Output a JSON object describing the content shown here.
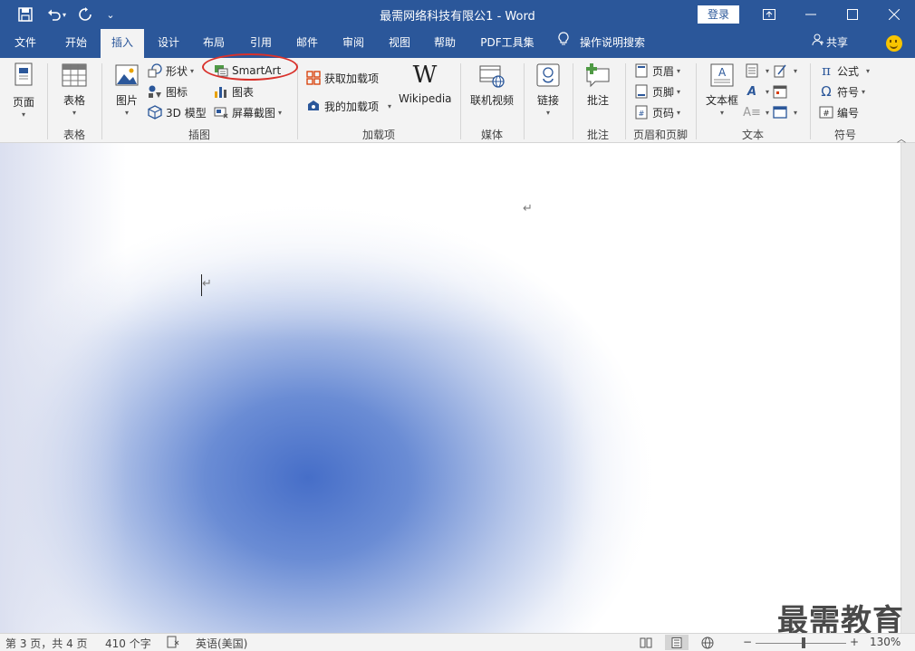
{
  "titlebar": {
    "title": "最需网络科技有限公1  -  Word",
    "login": "登录",
    "qat_customize": "⌄"
  },
  "tabs": [
    "文件",
    "开始",
    "插入",
    "设计",
    "布局",
    "引用",
    "邮件",
    "审阅",
    "视图",
    "帮助",
    "PDF工具集"
  ],
  "active_tab": "插入",
  "tell_me": "操作说明搜索",
  "share": "共享",
  "ribbon": {
    "pages": {
      "label": "页面"
    },
    "tables": {
      "button": "表格",
      "group": "表格"
    },
    "illustrations": {
      "picture": "图片",
      "shapes": "形状",
      "icons": "图标",
      "model3d": "3D 模型",
      "smartart": "SmartArt",
      "chart": "图表",
      "screenshot": "屏幕截图",
      "group": "插图"
    },
    "addins": {
      "get": "获取加载项",
      "my": "我的加载项",
      "wikipedia": "Wikipedia",
      "group": "加载项"
    },
    "media": {
      "online_video": "联机视频",
      "group": "媒体"
    },
    "links": {
      "link": "链接"
    },
    "comments": {
      "comment": "批注",
      "group": "批注"
    },
    "header_footer": {
      "header": "页眉",
      "footer": "页脚",
      "page_number": "页码",
      "group": "页眉和页脚"
    },
    "text": {
      "textbox": "文本框",
      "group": "文本"
    },
    "symbols": {
      "equation": "公式",
      "symbol": "符号",
      "number": "编号",
      "group": "符号"
    }
  },
  "document": {
    "para_mark": "↵"
  },
  "status": {
    "page": "第 3 页，共 4 页",
    "words": "410 个字",
    "language": "英语(美国)",
    "zoom": "130%",
    "zoom_minus": "−",
    "zoom_plus": "+"
  },
  "watermark": "最需教育",
  "colors": {
    "accent": "#2b579a",
    "ribbon_bg": "#f3f3f3",
    "highlight_circle": "#d9312b"
  }
}
